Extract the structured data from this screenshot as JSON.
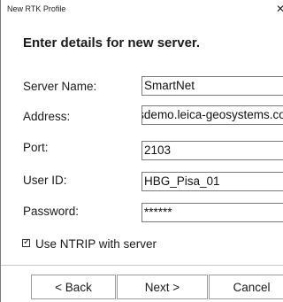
{
  "window": {
    "title": "New RTK Profile",
    "close_glyph": "✕"
  },
  "heading": "Enter details for new server.",
  "form": {
    "server_name": {
      "label": "Server Name:",
      "value": "SmartNet"
    },
    "address": {
      "label": "Address:",
      "value": "nrsdemo.leica-geosystems.com"
    },
    "port": {
      "label": "Port:",
      "value": "2103"
    },
    "user_id": {
      "label": "User ID:",
      "value": "HBG_Pisa_01"
    },
    "password": {
      "label": "Password:",
      "value": "******"
    }
  },
  "ntrip": {
    "label": "Use NTRIP with server",
    "checked": true,
    "check_glyph": "✓"
  },
  "buttons": {
    "back": "< Back",
    "next": "Next >",
    "cancel": "Cancel"
  }
}
